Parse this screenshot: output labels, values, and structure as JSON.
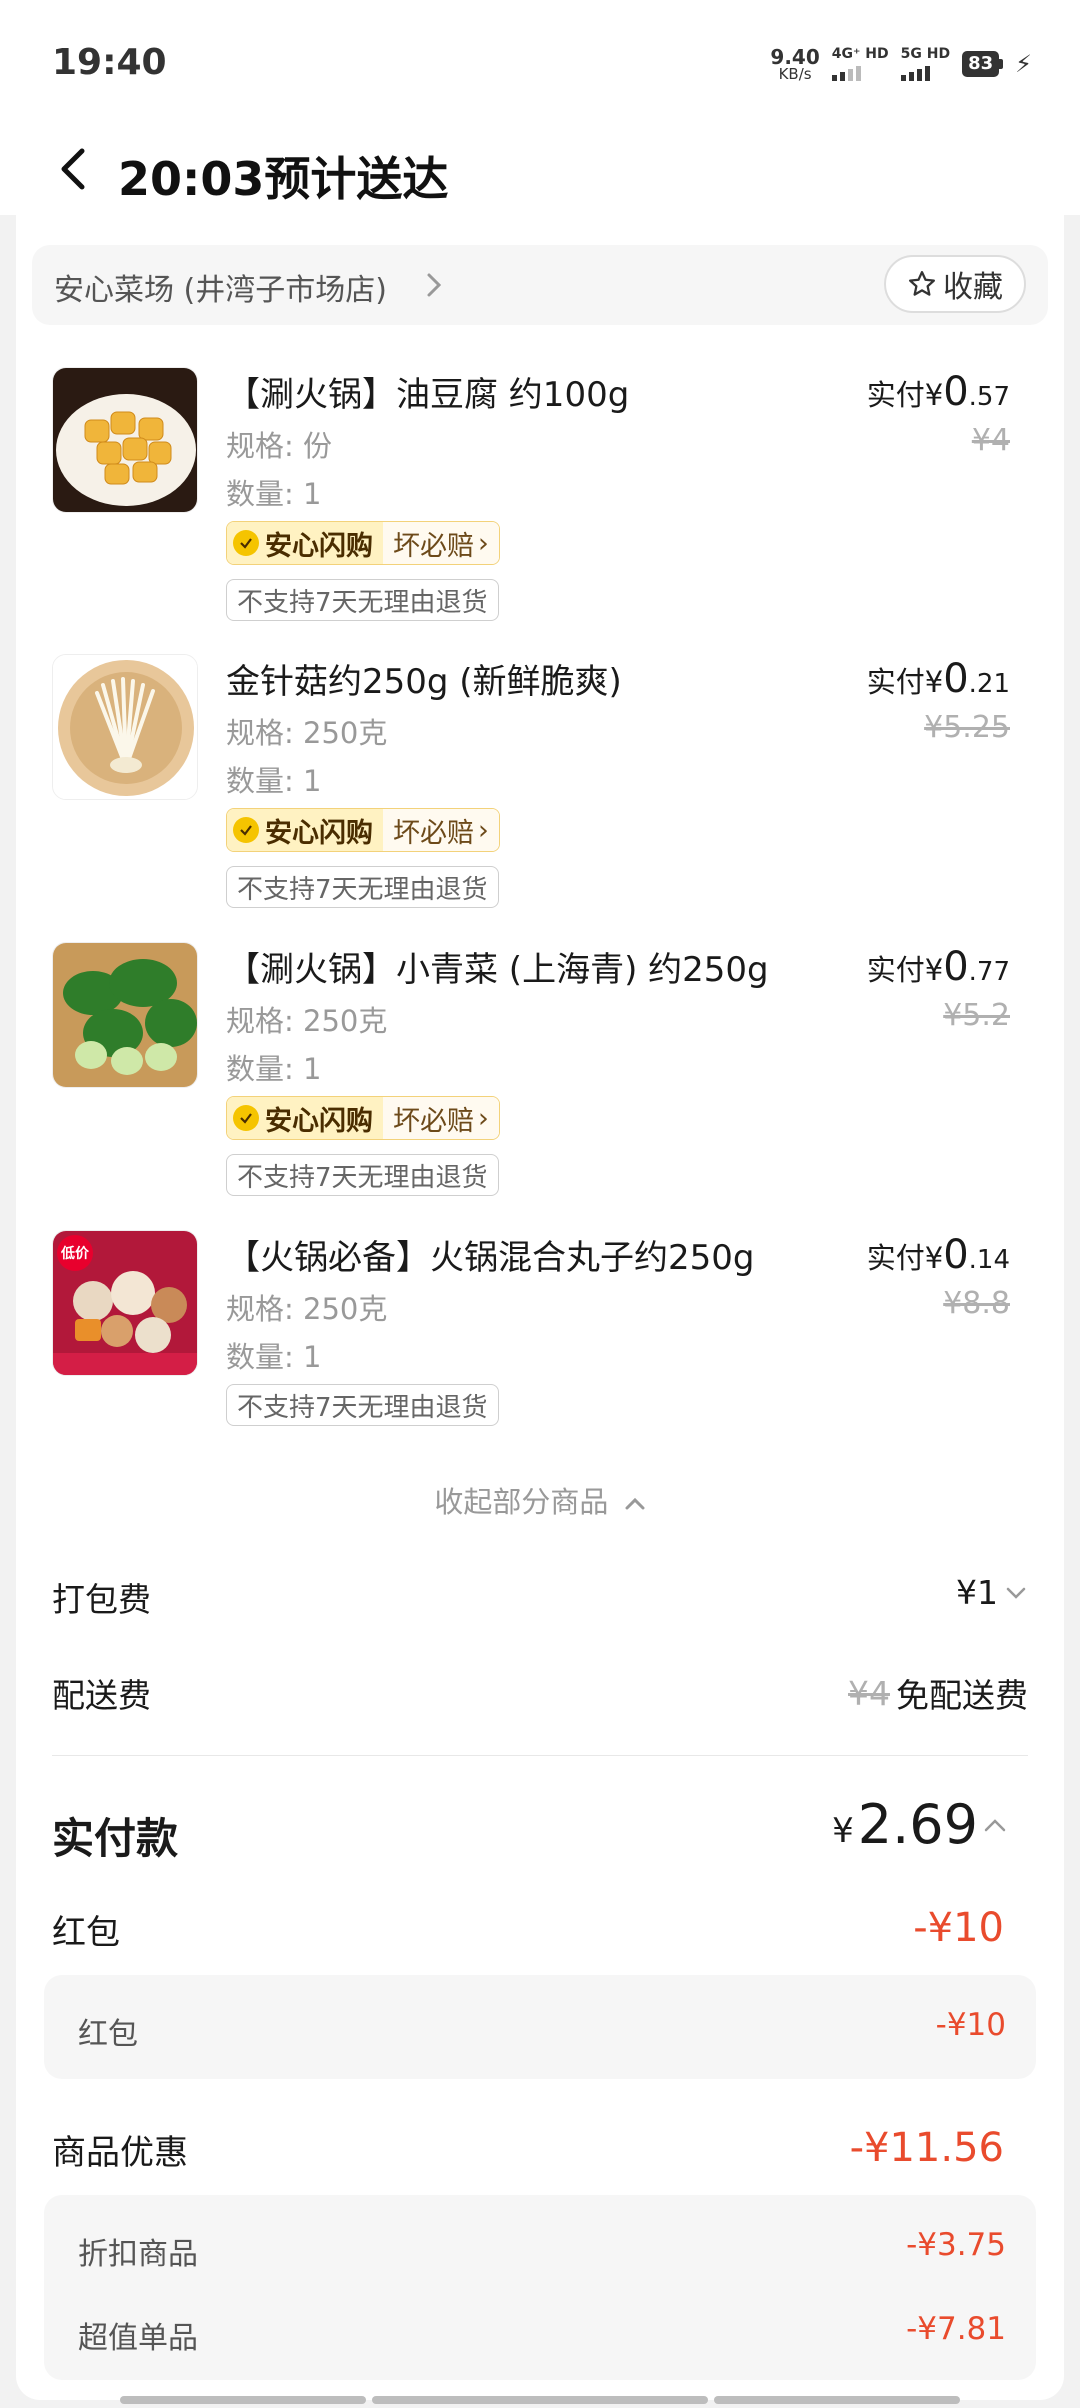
{
  "status_bar": {
    "time": "19:40",
    "net_speed": "9.40",
    "net_unit": "KB/s",
    "sim1": "4G⁺ HD",
    "sim2": "5G HD",
    "battery": "83"
  },
  "header": {
    "title": "20:03预计送达"
  },
  "store": {
    "name": "安心菜场 (井湾子市场店)",
    "favorite_label": "收藏"
  },
  "items": [
    {
      "title": "【涮火锅】油豆腐 约100g",
      "spec": "规格: 份",
      "qty": "数量: 1",
      "actual_label": "实付",
      "currency": "¥",
      "price_int": "0",
      "price_dec": ".57",
      "orig_price": "¥4",
      "badge_main": "安心闪购",
      "badge_sub": "坏必赔",
      "return_tag": "不支持7天无理由退货"
    },
    {
      "title": "金针菇约250g (新鲜脆爽)",
      "spec": "规格: 250克",
      "qty": "数量: 1",
      "actual_label": "实付",
      "currency": "¥",
      "price_int": "0",
      "price_dec": ".21",
      "orig_price": "¥5.25",
      "badge_main": "安心闪购",
      "badge_sub": "坏必赔",
      "return_tag": "不支持7天无理由退货"
    },
    {
      "title": "【涮火锅】小青菜 (上海青) 约250g",
      "spec": "规格: 250克",
      "qty": "数量: 1",
      "actual_label": "实付",
      "currency": "¥",
      "price_int": "0",
      "price_dec": ".77",
      "orig_price": "¥5.2",
      "badge_main": "安心闪购",
      "badge_sub": "坏必赔",
      "return_tag": "不支持7天无理由退货"
    },
    {
      "title": "【火锅必备】火锅混合丸子约250g",
      "spec": "规格: 250克",
      "qty": "数量: 1",
      "actual_label": "实付",
      "currency": "¥",
      "price_int": "0",
      "price_dec": ".14",
      "orig_price": "¥8.8",
      "thumb_tag": "低价",
      "return_tag": "不支持7天无理由退货"
    }
  ],
  "collapse_label": "收起部分商品",
  "fees": {
    "packing_label": "打包费",
    "packing_value": "¥1",
    "delivery_label": "配送费",
    "delivery_orig": "¥4",
    "delivery_value": "免配送费"
  },
  "total": {
    "label": "实付款",
    "currency": "¥",
    "value": "2.69"
  },
  "red_packet": {
    "label": "红包",
    "value": "-¥10",
    "sub_label": "红包",
    "sub_value": "-¥10"
  },
  "product_discount": {
    "label": "商品优惠",
    "value": "-¥11.56",
    "rows": [
      {
        "label": "折扣商品",
        "value": "-¥3.75"
      },
      {
        "label": "超值单品",
        "value": "-¥7.81"
      }
    ]
  },
  "colors": {
    "accent_red": "#e94b2d",
    "badge_yellow": "#f5c400"
  }
}
